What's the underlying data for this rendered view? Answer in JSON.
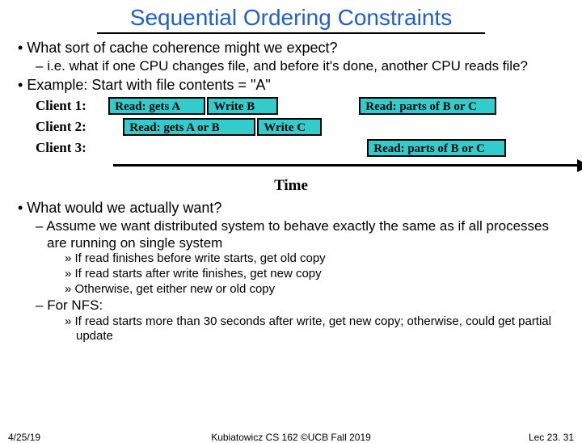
{
  "title": "Sequential Ordering Constraints",
  "bullets": {
    "b1": "What sort of cache coherence might we expect?",
    "b1a": "i.e. what if one CPU changes file, and before it's done, another CPU reads file?",
    "b2": "Example: Start with file contents = \"A\"",
    "b3": "What would we actually want?",
    "b3a": "Assume we want distributed system to behave exactly the same as if all processes are running on single system",
    "b3a1": "If read finishes before write starts, get old copy",
    "b3a2": "If read starts after write finishes, get new copy",
    "b3a3": "Otherwise, get either new or old copy",
    "b3b": "For NFS:",
    "b3b1": "If read starts more than 30 seconds after write, get new copy; otherwise, could get partial update"
  },
  "clients": {
    "c1": "Client 1:",
    "c2": "Client 2:",
    "c3": "Client 3:"
  },
  "boxes": {
    "r1a": "Read: gets A",
    "r1b": "Write B",
    "r1c": "Read: parts of B or C",
    "r2a": "Read: gets A or B",
    "r2b": "Write C",
    "r3a": "Read: parts of B or C"
  },
  "time_label": "Time",
  "footer": {
    "date": "4/25/19",
    "course": "Kubiatowicz CS 162 ©UCB Fall 2019",
    "lec": "Lec 23. 31"
  }
}
